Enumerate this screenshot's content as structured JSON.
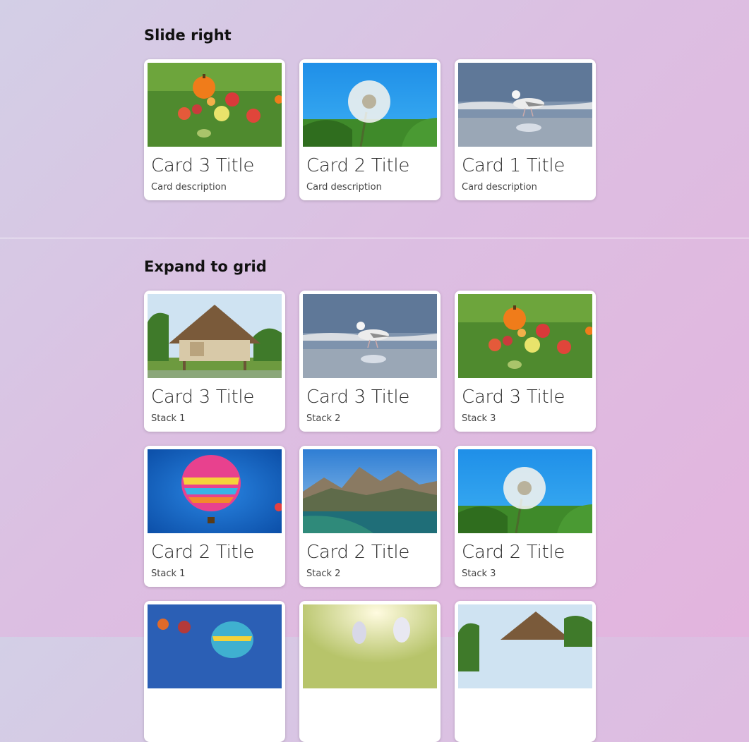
{
  "slide_right": {
    "heading": "Slide right",
    "cards": [
      {
        "title": "Card 3 Title",
        "description": "Card description",
        "image": "pumpkin-apples"
      },
      {
        "title": "Card 2 Title",
        "description": "Card description",
        "image": "dandelion"
      },
      {
        "title": "Card 1 Title",
        "description": "Card description",
        "image": "seagull"
      }
    ]
  },
  "expand_to_grid": {
    "heading": "Expand to grid",
    "rows": [
      [
        {
          "title": "Card 3 Title",
          "description": "Stack 1",
          "image": "hut"
        },
        {
          "title": "Card 3 Title",
          "description": "Stack 2",
          "image": "seagull"
        },
        {
          "title": "Card 3 Title",
          "description": "Stack 3",
          "image": "pumpkin-apples"
        }
      ],
      [
        {
          "title": "Card 2 Title",
          "description": "Stack 1",
          "image": "hot-air-balloon"
        },
        {
          "title": "Card 2 Title",
          "description": "Stack 2",
          "image": "mountains"
        },
        {
          "title": "Card 2 Title",
          "description": "Stack 3",
          "image": "dandelion"
        }
      ],
      [
        {
          "image": "balloons"
        },
        {
          "image": "bunnies"
        },
        {
          "image": "hut"
        }
      ]
    ]
  }
}
